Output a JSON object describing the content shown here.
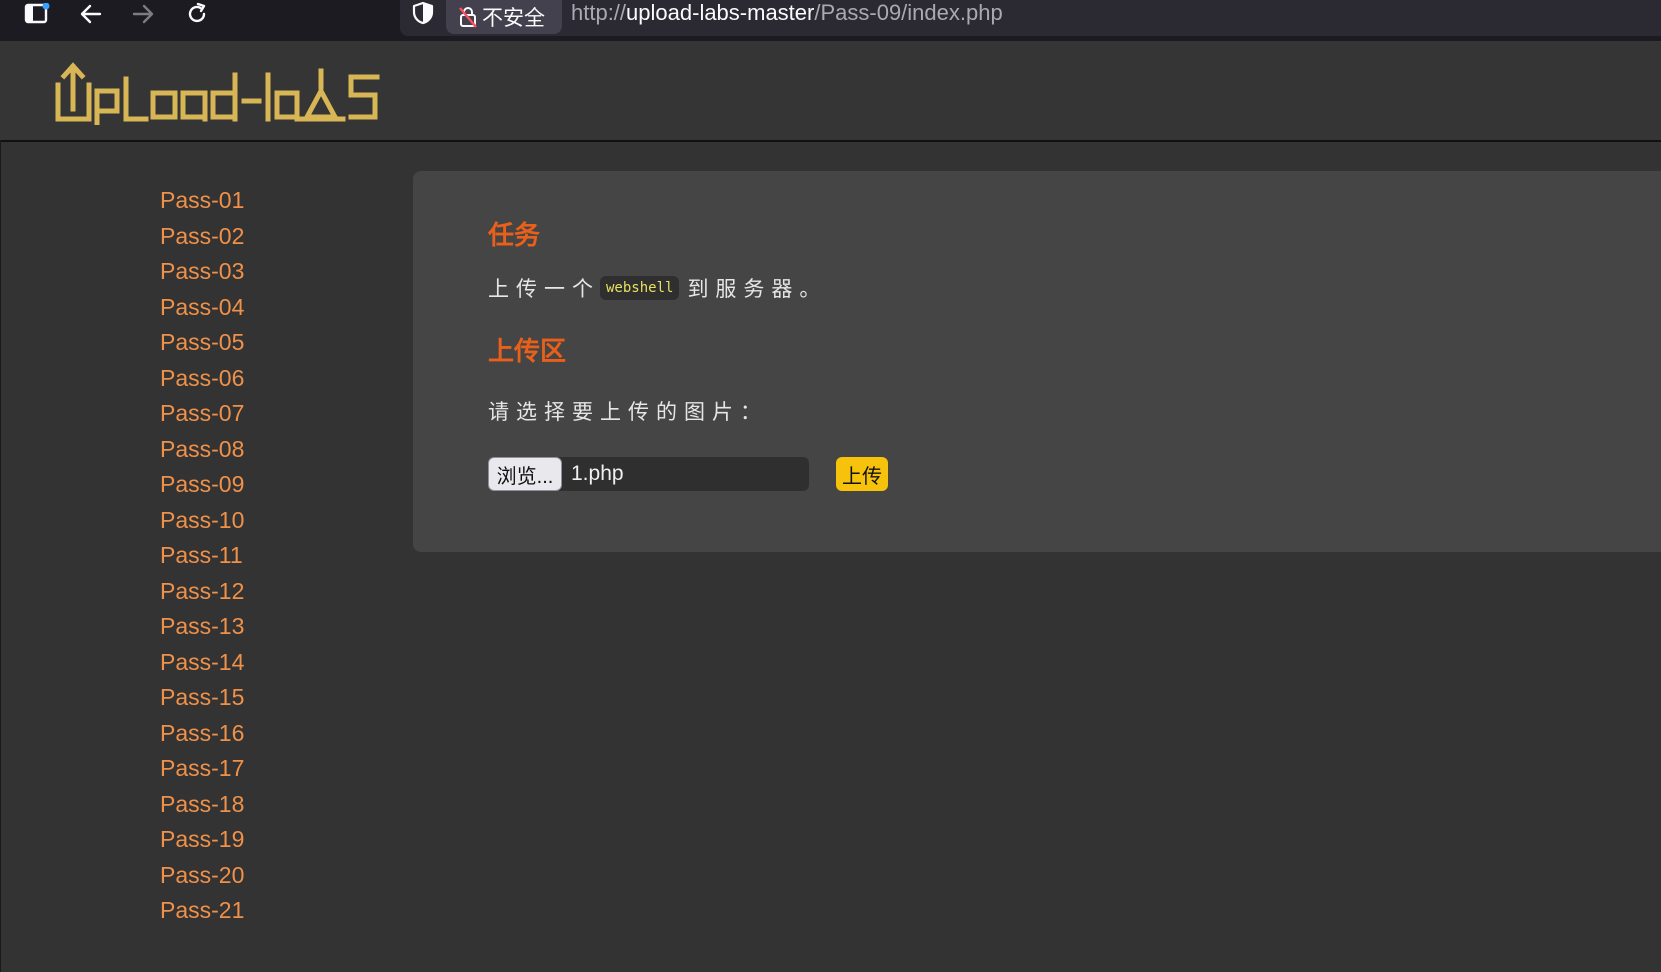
{
  "browser": {
    "security_label": "不安全",
    "url_scheme": "http://",
    "url_host": "upload-labs-master",
    "url_path": "/Pass-09/index.php"
  },
  "site": {
    "logo_text": "Upload-labs",
    "logo_color": "#d8b655"
  },
  "sidebar": {
    "link_color": "#f0914a",
    "items": [
      {
        "label": "Pass-01"
      },
      {
        "label": "Pass-02"
      },
      {
        "label": "Pass-03"
      },
      {
        "label": "Pass-04"
      },
      {
        "label": "Pass-05"
      },
      {
        "label": "Pass-06"
      },
      {
        "label": "Pass-07"
      },
      {
        "label": "Pass-08"
      },
      {
        "label": "Pass-09"
      },
      {
        "label": "Pass-10"
      },
      {
        "label": "Pass-11"
      },
      {
        "label": "Pass-12"
      },
      {
        "label": "Pass-13"
      },
      {
        "label": "Pass-14"
      },
      {
        "label": "Pass-15"
      },
      {
        "label": "Pass-16"
      },
      {
        "label": "Pass-17"
      },
      {
        "label": "Pass-18"
      },
      {
        "label": "Pass-19"
      },
      {
        "label": "Pass-20"
      },
      {
        "label": "Pass-21"
      }
    ]
  },
  "task": {
    "title": "任务",
    "text_before": "上传一个",
    "code": "webshell",
    "text_after": "到服务器。"
  },
  "upload": {
    "title": "上传区",
    "prompt": "请选择要上传的图片：",
    "browse_label": "浏览...",
    "file_name": "1.php",
    "submit_label": "上传"
  },
  "colors": {
    "heading": "#e8601a",
    "submit_bg": "#f6c20b",
    "page_bg": "#333333",
    "panel_bg": "#454545"
  }
}
